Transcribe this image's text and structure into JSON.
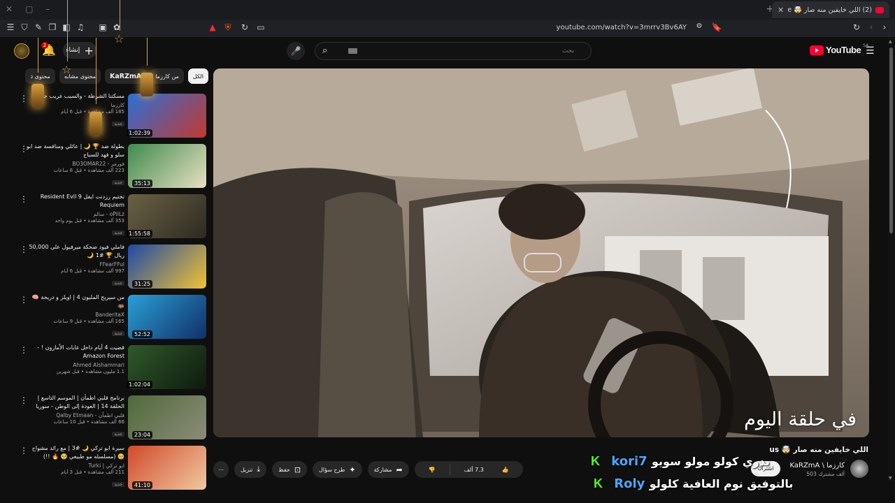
{
  "browser": {
    "tab_title": "(2) اللي خايفين منه صار 🤯 YouTube",
    "url": "youtube.com/watch?v=3mrrv3Bv6AY"
  },
  "header": {
    "create_label": "إنشاء",
    "notifications_count": "2",
    "search_placeholder": "بحث",
    "logo_text": "YouTube",
    "region": "SA"
  },
  "chips": [
    {
      "label": "الكل",
      "active": true
    },
    {
      "label": "من كارزما",
      "active": false
    },
    {
      "label": "KaRZmA",
      "active": false
    },
    {
      "label": "محتوى مشابه",
      "active": false
    },
    {
      "label": "محتوى ذ",
      "active": false
    }
  ],
  "recommendations": [
    {
      "title": "مسكتنا الشرطة - والسبب غريب جداً 🤯",
      "channel": "كارزما",
      "meta": "185 ألف مشاهدة • قبل 6 أيام",
      "badge": "جديد",
      "duration": "1:02:39"
    },
    {
      "title": "بطولة ضد 🏆 🌙 | عائلي ومنافسة ضد ابو سلو و فهد للسباح",
      "channel": "فورمر - BO3OMAR22",
      "meta": "223 ألف مشاهدة • قبل 8 ساعات",
      "badge": "جديد",
      "duration": "35:13"
    },
    {
      "title": "تختيم رزدنت ايفل Resident Evil 9 Requiem",
      "channel": "oPiiLz - سالم",
      "meta": "353 ألف مشاهدة • قبل يوم واحد",
      "badge": "جديد",
      "duration": "1:55:58"
    },
    {
      "title": "فاملي فيود ضحكة ميرفيول على 50,000 ريال 🏆 #1 🌙",
      "channel": "FFearFFul",
      "meta": "997 ألف مشاهدة • قبل 6 أيام",
      "badge": "جديد",
      "duration": "31:25"
    },
    {
      "title": "من سيربح المليون 4 | اويلز و دريحة 🧠 🦛",
      "channel": "BanderitaX",
      "meta": "165 ألف مشاهدة • قبل 9 ساعات",
      "badge": "جديد",
      "duration": "52:52"
    },
    {
      "title": "قضيت 4 أيام داخل غابات الأمازون ! - Amazon Forest",
      "channel": "Ahmed Alshammari",
      "meta": "1.1 مليون مشاهدة • قبل شهرين",
      "badge": "",
      "duration": "1:02:04"
    },
    {
      "title": "برنامج قلبي اطمأن | الموسم التاسع | الحلقة 14 | العودة إلى الوطن - سوريا",
      "channel": "قلبي اطمأن - Qalby Etmaan",
      "meta": "66 ألف مشاهدة • قبل 10 ساعات",
      "badge": "جديد",
      "duration": "23:04"
    },
    {
      "title": "سيرة ابو تركي 🌙 #3 | مع رائد مشواح 🥺 (مسلسله مو طبيعي 🥺 🔥 !!)",
      "channel": "ابو تركي | Turki",
      "meta": "211 ألف مشاهدة • قبل 3 أيام",
      "badge": "جديد",
      "duration": "41:10"
    }
  ],
  "video": {
    "caption": "في حلقة اليوم",
    "title": "اللي خايفين منه صار 🤯 us",
    "channel_name": "KaRZmA \\ كارزما",
    "subscribers": "503 ألف مشترك",
    "subscribe_label": "اشتراك",
    "likes": "7.3 ألف",
    "share_label": "مشاركة",
    "ask_label": "طرح سؤال",
    "save_label": "حفظ",
    "download_label": "تنزيل"
  },
  "chat": [
    {
      "k": "K",
      "name": "kori7",
      "msg": "بدري كولو مولو سويو"
    },
    {
      "k": "K",
      "name": "Roly",
      "msg": "بالتوفيق نوم العافية كلولو"
    }
  ],
  "colors": {
    "background": "#0f0f0f",
    "yt_red": "#ff0033",
    "kick_green": "#53fc18",
    "chat_name_blue": "#4aa6ff"
  }
}
